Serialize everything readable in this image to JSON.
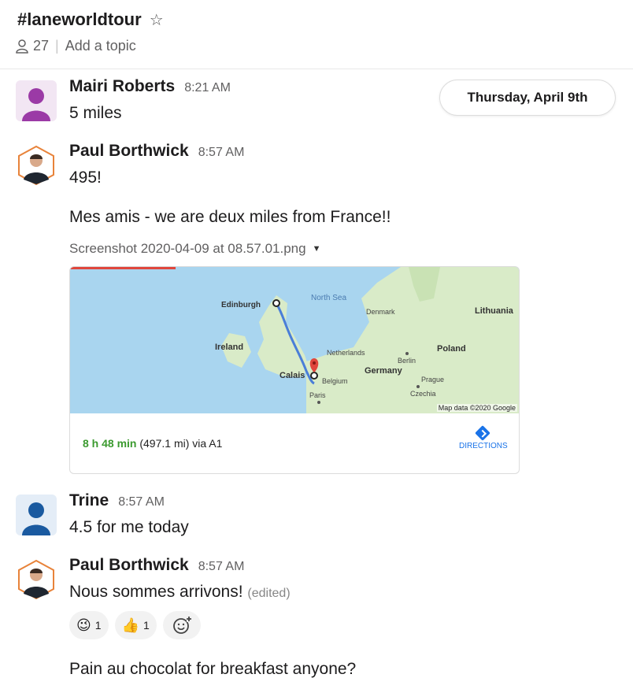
{
  "channel": {
    "name": "#laneworldtour",
    "star_icon": "☆",
    "members_icon": "person-icon",
    "member_count": "27",
    "separator": "|",
    "topic_placeholder": "Add a topic"
  },
  "date_divider": "Thursday, April 9th",
  "messages": [
    {
      "author": "Mairi Roberts",
      "time": "8:21 AM",
      "text": "5 miles"
    },
    {
      "author": "Paul Borthwick",
      "time": "8:57 AM",
      "text": "495!",
      "text2": "Mes amis - we are deux miles from France!!",
      "file_name": "Screenshot 2020-04-09 at 08.57.01.png",
      "file_caret": "▼",
      "map": {
        "labels": {
          "north_sea": "North Sea",
          "edinburgh": "Edinburgh",
          "denmark": "Denmark",
          "lithuania": "Lithuania",
          "ireland": "Ireland",
          "netherlands": "Netherlands",
          "berlin": "Berlin",
          "poland": "Poland",
          "germany": "Germany",
          "calais": "Calais",
          "belgium": "Belgium",
          "prague": "Prague",
          "czechia": "Czechia",
          "paris": "Paris"
        },
        "credit": "Map data ©2020 Google",
        "duration": "8 h 48 min",
        "distance_route": " (497.1 mi) via A1",
        "directions_label": "DIRECTIONS",
        "colors": {
          "water": "#a9d5ef",
          "land": "#d9ebc8",
          "route": "#4a7ed8",
          "duration": "#3b9a2f"
        }
      }
    },
    {
      "author": "Trine",
      "time": "8:57 AM",
      "text": "4.5 for me today"
    },
    {
      "author": "Paul Borthwick",
      "time": "8:57 AM",
      "text": "Nous sommes arrivons!",
      "edited": "(edited)",
      "reactions": [
        {
          "emoji": "😉",
          "count": "1"
        },
        {
          "emoji": "👍",
          "count": "1"
        }
      ],
      "add_reaction_icon": "add-emoji-icon",
      "text2": "Pain au chocolat for breakfast anyone?"
    }
  ]
}
